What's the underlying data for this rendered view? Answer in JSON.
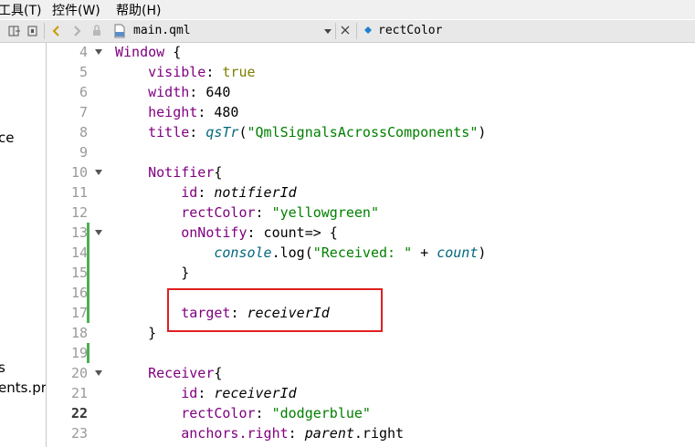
{
  "menubar": {
    "tools": "工具(T)",
    "controls": "控件(W)",
    "help": "帮助(H)"
  },
  "toolbar": {
    "file_name": "main.qml",
    "symbol_name": "rectColor"
  },
  "project_pane": {
    "fragments": [
      "ce",
      "s",
      "ents.pro"
    ]
  },
  "editor": {
    "current_line": "22",
    "lines": [
      {
        "n": "4",
        "fold": true,
        "changed": false
      },
      {
        "n": "5",
        "fold": false,
        "changed": false
      },
      {
        "n": "6",
        "fold": false,
        "changed": false
      },
      {
        "n": "7",
        "fold": false,
        "changed": false
      },
      {
        "n": "8",
        "fold": false,
        "changed": false
      },
      {
        "n": "9",
        "fold": false,
        "changed": false
      },
      {
        "n": "10",
        "fold": true,
        "changed": false
      },
      {
        "n": "11",
        "fold": false,
        "changed": false
      },
      {
        "n": "12",
        "fold": false,
        "changed": false
      },
      {
        "n": "13",
        "fold": true,
        "changed": true
      },
      {
        "n": "14",
        "fold": false,
        "changed": true
      },
      {
        "n": "15",
        "fold": false,
        "changed": true
      },
      {
        "n": "16",
        "fold": false,
        "changed": true
      },
      {
        "n": "17",
        "fold": false,
        "changed": true
      },
      {
        "n": "18",
        "fold": false,
        "changed": false
      },
      {
        "n": "19",
        "fold": false,
        "changed": true
      },
      {
        "n": "20",
        "fold": true,
        "changed": false
      },
      {
        "n": "21",
        "fold": false,
        "changed": false
      },
      {
        "n": "22",
        "fold": false,
        "changed": false
      },
      {
        "n": "23",
        "fold": false,
        "changed": false
      }
    ],
    "code": {
      "l4_type": "Window",
      "l4_brace": " {",
      "l5_prop": "visible",
      "l5_val": " true",
      "l6_prop": "width",
      "l6_val": " 640",
      "l7_prop": "height",
      "l7_val": " 480",
      "l8_prop": "title",
      "l8_fn": "qsTr",
      "l8_str": "\"QmlSignalsAcrossComponents\"",
      "l10_type": "Notifier",
      "l10_brace": "{",
      "l11_prop": "id",
      "l11_val": "notifierId",
      "l12_prop": "rectColor",
      "l12_str": "\"yellowgreen\"",
      "l13_prop": "onNotify",
      "l13_rest": " count=> {",
      "l14_obj": "console",
      "l14_call": ".log(",
      "l14_str": "\"Received: \"",
      "l14_plus": " + ",
      "l14_arg": "count",
      "l14_close": ")",
      "l15_brace": "}",
      "l17_prop": "target",
      "l17_val": "receiverId",
      "l18_brace": "}",
      "l20_type": "Receiver",
      "l20_brace": "{",
      "l21_prop": "id",
      "l21_val": "receiverId",
      "l22_prop": "rectColor",
      "l22_str": "\"dodgerblue\"",
      "l23_prop": "anchors.right",
      "l23_obj": "parent",
      "l23_rest": ".right"
    }
  }
}
